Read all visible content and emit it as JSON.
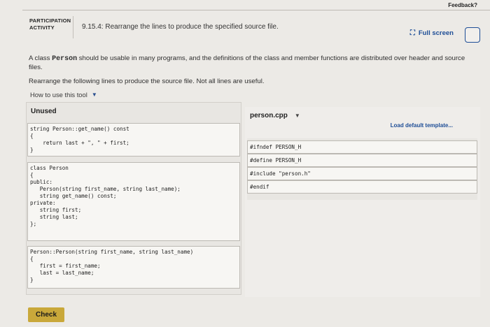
{
  "feedback_label": "Feedback?",
  "activity": {
    "label_line1": "PARTICIPATION",
    "label_line2": "ACTIVITY",
    "title": "9.15.4: Rearrange the lines to produce the specified source file.",
    "fullscreen_label": "Full screen"
  },
  "description": {
    "before": "A class ",
    "code": "Person",
    "after": " should be usable in many programs, and the definitions of the class and member functions are distributed over header and source files."
  },
  "instruction": "Rearrange the following lines to produce the source file. Not all lines are useful.",
  "howto_label": "How to use this tool",
  "unused": {
    "title": "Unused",
    "blocks": [
      {
        "lines": [
          "string Person::get_name() const",
          "{",
          "    return last + \", \" + first;",
          "}"
        ]
      },
      {
        "lines": [
          "class Person",
          "{",
          "public:",
          "   Person(string first_name, string last_name);",
          "   string get_name() const;",
          "private:",
          "   string first;",
          "   string last;",
          "};"
        ]
      },
      {
        "lines": [
          "Person::Person(string first_name, string last_name)",
          "{",
          "   first = first_name;",
          "   last = last_name;",
          "}"
        ]
      }
    ]
  },
  "target": {
    "file_name": "person.cpp",
    "load_default_label": "Load default template...",
    "lines": [
      "#ifndef PERSON_H",
      "#define PERSON_H",
      "#include \"person.h\"",
      "#endif"
    ]
  },
  "check_label": "Check"
}
